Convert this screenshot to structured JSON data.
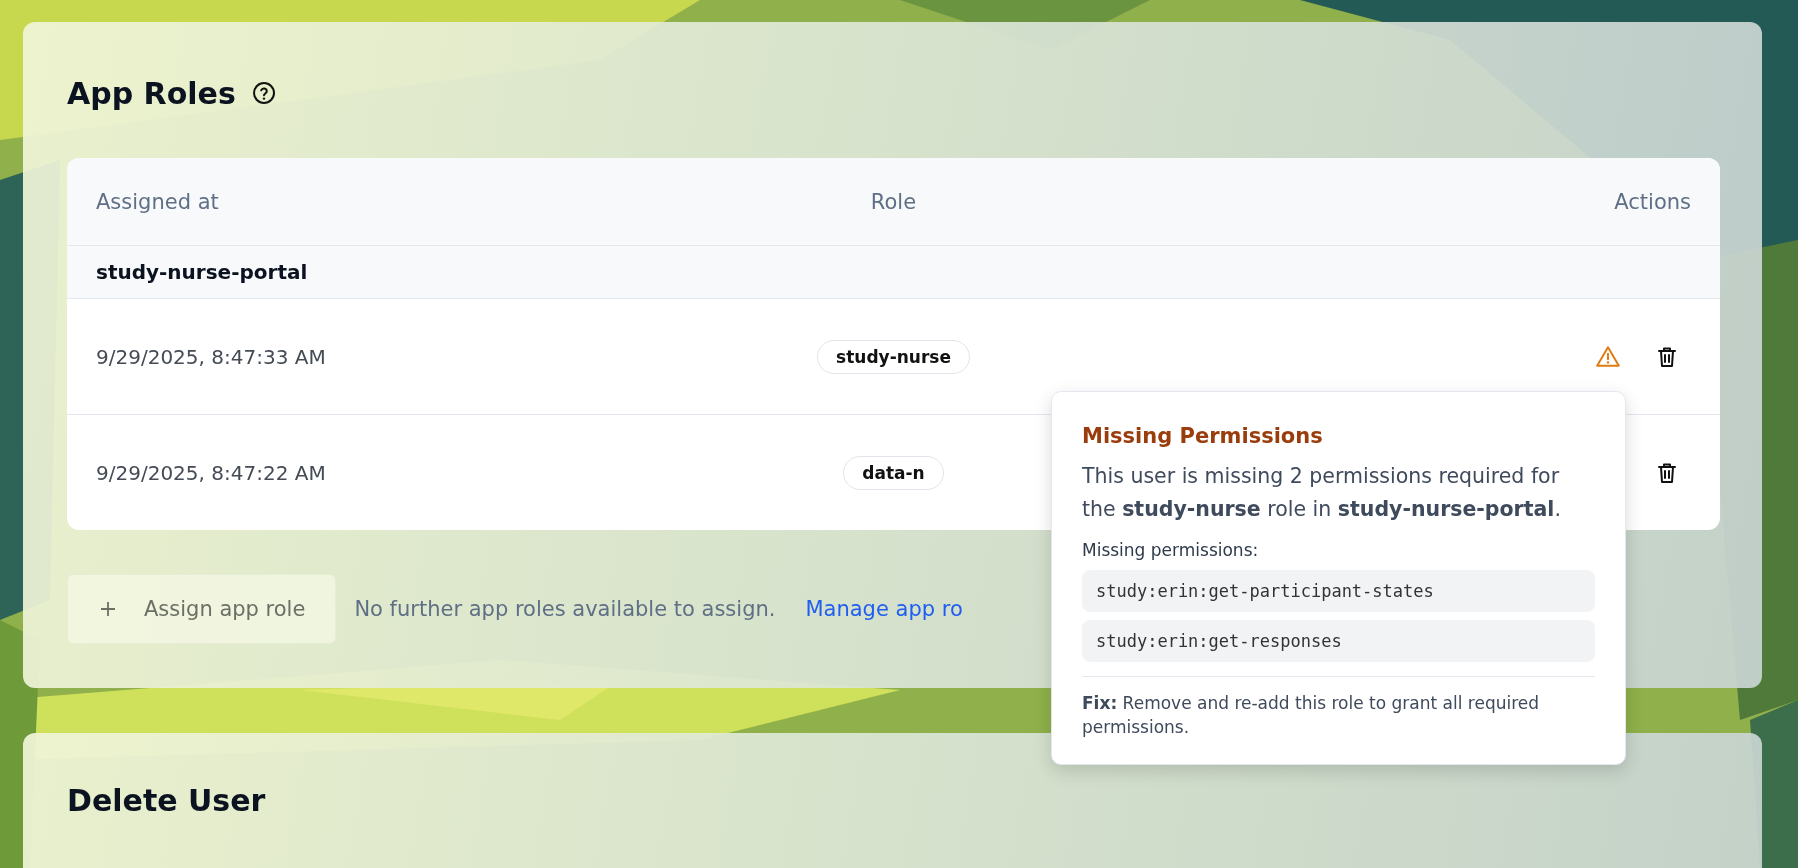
{
  "section": {
    "title": "App Roles"
  },
  "table": {
    "columns": [
      "Assigned at",
      "Role",
      "Actions"
    ],
    "groups": [
      {
        "name": "study-nurse-portal",
        "rows": [
          {
            "assigned_at": "9/29/2025, 8:47:33 AM",
            "role": "study-nurse",
            "warning": true
          },
          {
            "assigned_at": "9/29/2025, 8:47:22 AM",
            "role": "data-n"
          }
        ]
      }
    ]
  },
  "assign_button": {
    "label": "Assign app role",
    "disabled": true
  },
  "note": "No further app roles available to assign.",
  "link": "Manage app ro",
  "tooltip": {
    "title": "Missing Permissions",
    "message": "This user is missing 2 permissions required for the **study-nurse** role in **study-nurse-portal**.",
    "list_label": "Missing permissions:",
    "permissions": [
      "study:erin:get-participant-states",
      "study:erin:get-responses"
    ],
    "fix": "**Fix:** Remove and re-add this role to grant all required permissions."
  },
  "delete_section": {
    "title": "Delete User"
  }
}
